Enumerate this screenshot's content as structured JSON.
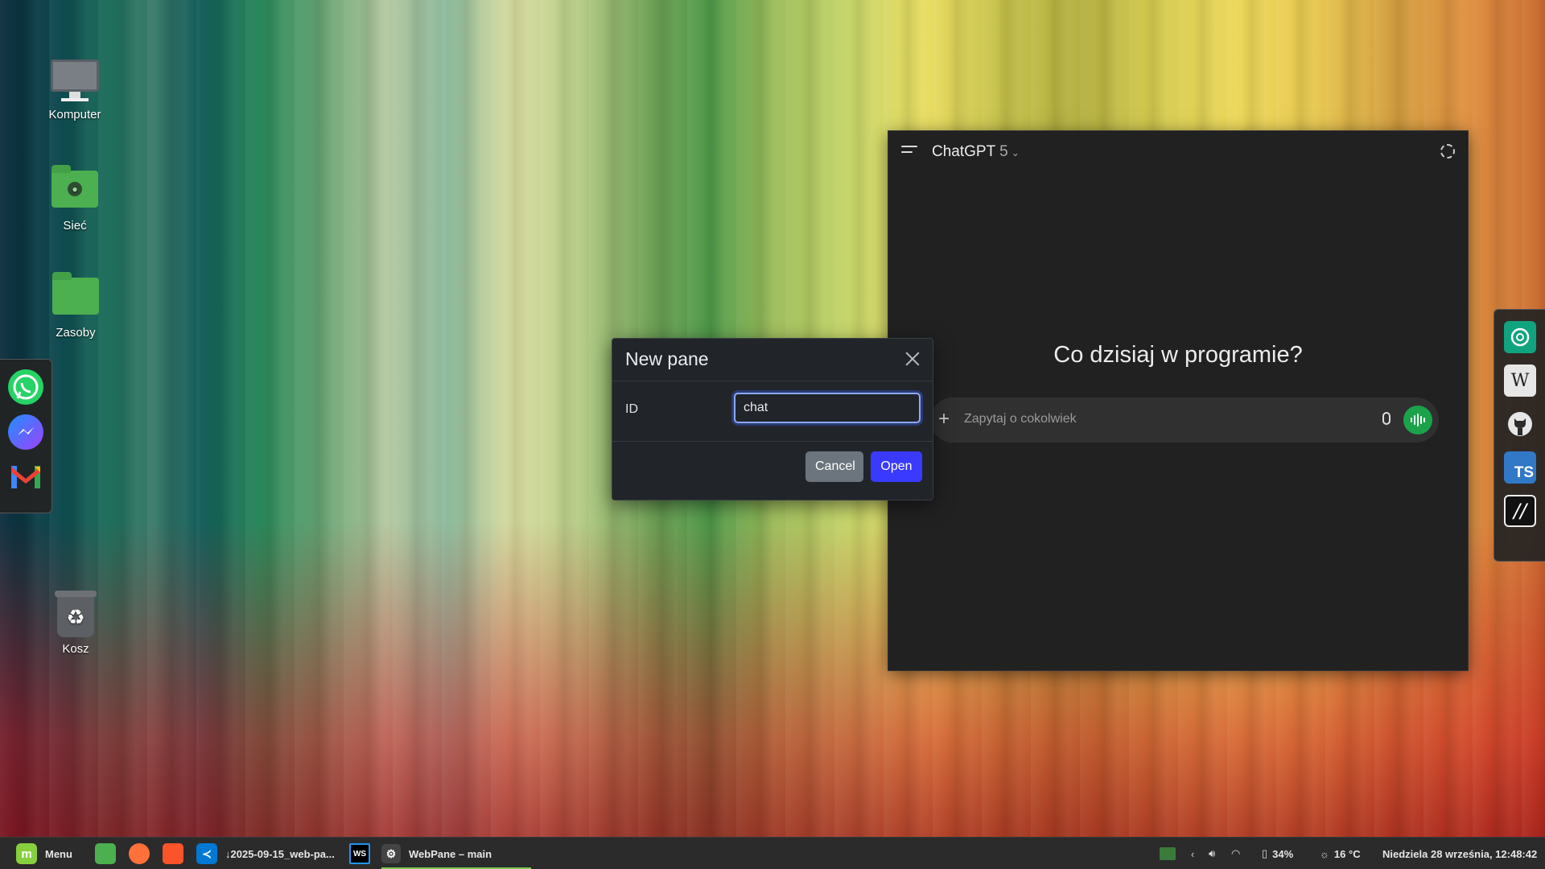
{
  "desktop": {
    "icons": [
      {
        "label": "Komputer",
        "icon": "computer-icon"
      },
      {
        "label": "Sieć",
        "icon": "network-folder-icon"
      },
      {
        "label": "Zasoby",
        "icon": "folder-icon"
      },
      {
        "label": "Kosz",
        "icon": "trash-icon"
      }
    ]
  },
  "left_dock": {
    "apps": [
      "whatsapp-icon",
      "messenger-icon",
      "gmail-icon"
    ]
  },
  "right_dock": {
    "apps": [
      "chatgpt-icon",
      "wikipedia-icon",
      "github-icon",
      "typescript-icon",
      "webpane-icon"
    ],
    "wikipedia_glyph": "W",
    "ts_glyph": "TS",
    "slash_glyph": "//"
  },
  "chat": {
    "title": "ChatGPT",
    "version": "5",
    "heading": "Co dzisiaj w programie?",
    "placeholder": "Zapytaj o cokolwiek",
    "plus": "+",
    "accent": "#1aa34a"
  },
  "dialog": {
    "title": "New pane",
    "id_label": "ID",
    "id_value": "chat",
    "cancel_label": "Cancel",
    "open_label": "Open",
    "open_color": "#3a3aff"
  },
  "taskbar": {
    "menu_label": "Menu",
    "download_item": "↓2025-09-15_web-pa...",
    "webpane_item": "WebPane – main",
    "battery": "34%",
    "weather": "16 °C",
    "datetime": "Niedziela 28 września, 12:48:42",
    "ws_glyph": "WS"
  }
}
